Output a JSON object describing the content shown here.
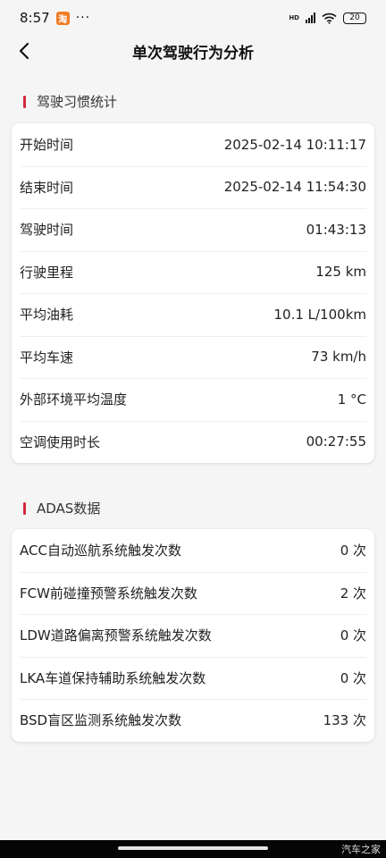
{
  "status_bar": {
    "time": "8:57",
    "app_badge": "淘",
    "overflow": "···",
    "network": "HD",
    "battery": "20"
  },
  "header": {
    "title": "单次驾驶行为分析"
  },
  "driving_habits": {
    "title": "驾驶习惯统计",
    "rows": [
      {
        "label": "开始时间",
        "value": "2025-02-14 10:11:17"
      },
      {
        "label": "结束时间",
        "value": "2025-02-14 11:54:30"
      },
      {
        "label": "驾驶时间",
        "value": "01:43:13"
      },
      {
        "label": "行驶里程",
        "value": "125 km"
      },
      {
        "label": "平均油耗",
        "value": "10.1 L/100km"
      },
      {
        "label": "平均车速",
        "value": "73 km/h"
      },
      {
        "label": "外部环境平均温度",
        "value": "1 °C"
      },
      {
        "label": "空调使用时长",
        "value": "00:27:55"
      }
    ]
  },
  "adas": {
    "title": "ADAS数据",
    "rows": [
      {
        "label": "ACC自动巡航系统触发次数",
        "value": "0 次"
      },
      {
        "label": "FCW前碰撞预警系统触发次数",
        "value": "2 次"
      },
      {
        "label": "LDW道路偏离预警系统触发次数",
        "value": "0 次"
      },
      {
        "label": "LKA车道保持辅助系统触发次数",
        "value": "0 次"
      },
      {
        "label": "BSD盲区监测系统触发次数",
        "value": "133 次"
      }
    ]
  },
  "watermark": "汽车之家",
  "colors": {
    "accent": "#d0293c",
    "background": "#f6f5f5",
    "card": "#ffffff"
  }
}
